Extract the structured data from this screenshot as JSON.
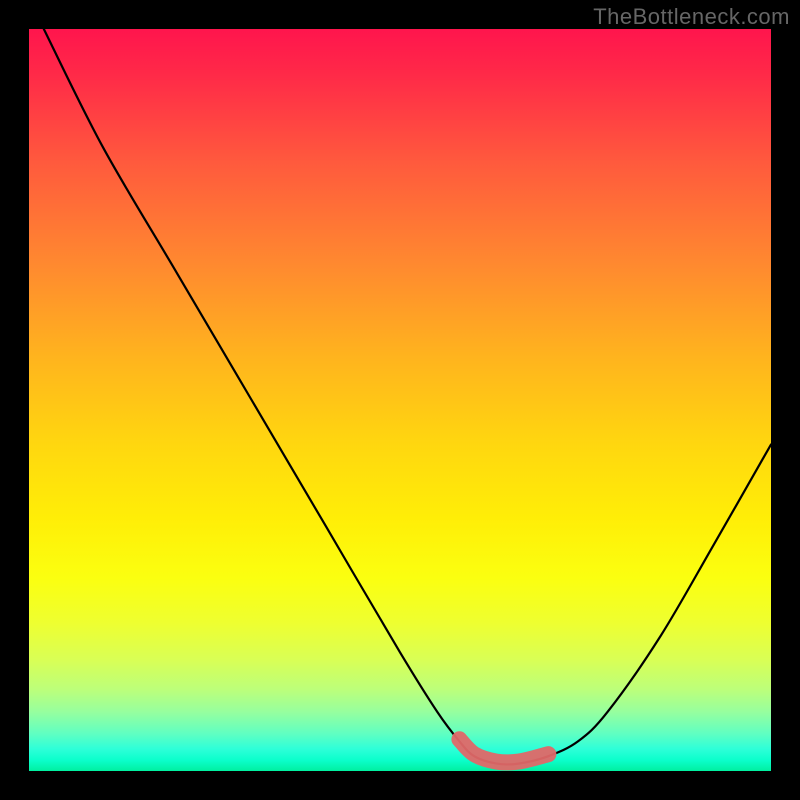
{
  "watermark": "TheBottleneck.com",
  "chart_data": {
    "type": "line",
    "title": "",
    "xlabel": "",
    "ylabel": "",
    "xlim": [
      0,
      100
    ],
    "ylim": [
      0,
      100
    ],
    "series": [
      {
        "name": "bottleneck-curve",
        "x": [
          2,
          10,
          20,
          30,
          40,
          50,
          55,
          58,
          60,
          63,
          66,
          70,
          74,
          78,
          85,
          92,
          100
        ],
        "values": [
          100,
          84,
          67,
          50,
          33,
          16,
          8,
          4,
          2,
          1,
          1,
          2,
          4,
          8,
          18,
          30,
          44
        ]
      }
    ],
    "flat_region_x": [
      57,
      72
    ],
    "gradient_stops": [
      {
        "pos": 0.0,
        "color": "#ff154d"
      },
      {
        "pos": 0.3,
        "color": "#ff8a2f"
      },
      {
        "pos": 0.6,
        "color": "#ffee07"
      },
      {
        "pos": 0.85,
        "color": "#bcff7a"
      },
      {
        "pos": 1.0,
        "color": "#00f0a0"
      }
    ]
  }
}
